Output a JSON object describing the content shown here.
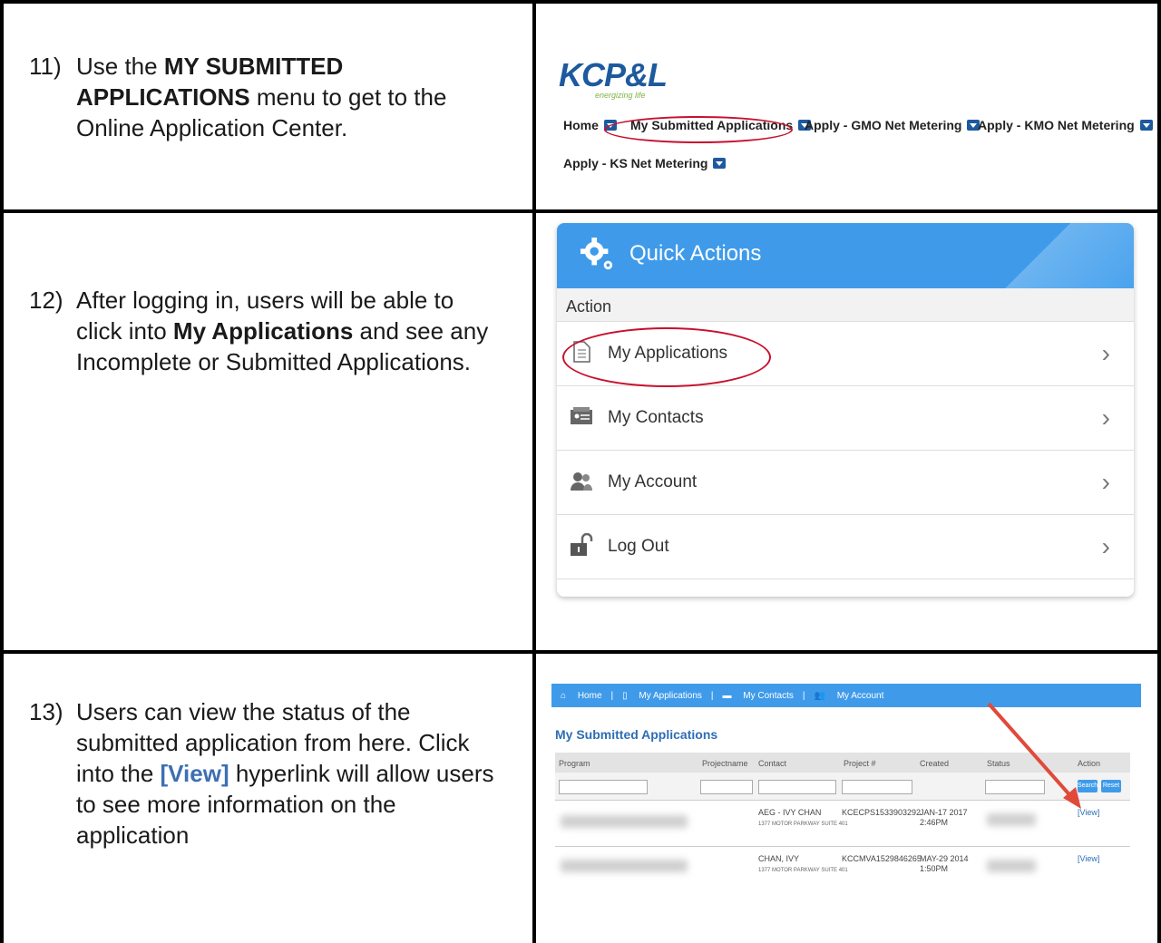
{
  "rows": [
    {
      "number": "11)",
      "text_before": "Use the ",
      "bold": "MY SUBMITTED APPLICATIONS",
      "text_after": " menu to get to the Online Application Center."
    },
    {
      "number": "12)",
      "text_before": "After logging in, users will be able to click into ",
      "bold": "My Applications",
      "text_after": " and see any Incomplete or Submitted Applications."
    },
    {
      "number": "13)",
      "text_before": "Users can view the status of the submitted application from here. Click into the ",
      "bold": "[View]",
      "text_after": " hyperlink will allow users to see more information on the application"
    }
  ],
  "kcpl": {
    "logo": "KCP&L",
    "tagline": "energizing life",
    "nav": [
      "Home",
      "My Submitted Applications",
      "Apply - GMO Net Metering",
      "Apply - KMO Net Metering",
      "Apply - KS Net Metering"
    ]
  },
  "quick_actions": {
    "title": "Quick Actions",
    "subheader": "Action",
    "items": [
      "My Applications",
      "My Contacts",
      "My Account",
      "Log Out"
    ]
  },
  "submitted": {
    "nav": [
      "Home",
      "My Applications",
      "My Contacts",
      "My Account"
    ],
    "title": "My Submitted Applications",
    "columns": [
      "Program",
      "Projectname",
      "Contact",
      "Project #",
      "Created",
      "Status",
      "Action"
    ],
    "search_btn": "Search",
    "reset_btn": "Reset",
    "rows": [
      {
        "contact": "AEG - IVY CHAN",
        "address": "1377 MOTOR PARKWAY SUITE 401",
        "project": "KCECPS1533903292",
        "created_date": "JAN-17 2017",
        "created_time": "2:46PM",
        "action": "[View]"
      },
      {
        "contact": "CHAN, IVY",
        "address": "1377 MOTOR PARKWAY SUITE 401",
        "project": "KCCMVA1529846265",
        "created_date": "MAY-29 2014",
        "created_time": "1:50PM",
        "action": "[View]"
      }
    ]
  },
  "colors": {
    "accent": "#3f9bea",
    "highlight": "#c8102e",
    "link": "#2e6db4"
  }
}
